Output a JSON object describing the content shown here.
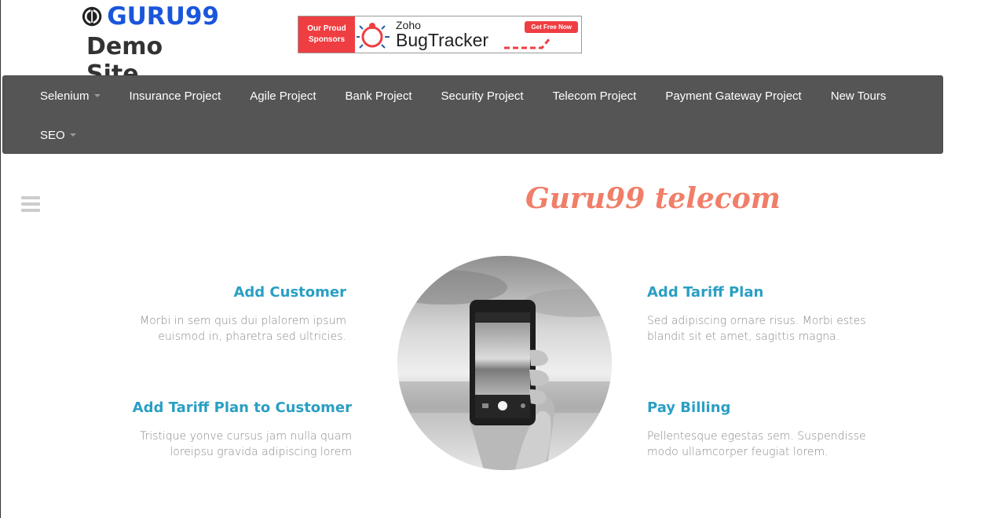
{
  "logo": {
    "brand": "GURU99",
    "subtitle": "Demo Site"
  },
  "sponsor": {
    "left_line1": "Our Proud",
    "left_line2": "Sponsors",
    "product_top": "Zoho",
    "product_name": "BugTracker",
    "cta": "Get Free Now"
  },
  "nav": {
    "row1": [
      {
        "label": "Selenium",
        "dropdown": true
      },
      {
        "label": "Insurance Project"
      },
      {
        "label": "Agile Project"
      },
      {
        "label": "Bank Project"
      },
      {
        "label": "Security Project"
      },
      {
        "label": "Telecom Project"
      },
      {
        "label": "Payment Gateway Project"
      },
      {
        "label": "New Tours"
      }
    ],
    "row2": [
      {
        "label": "SEO",
        "dropdown": true
      }
    ]
  },
  "brand_title": "Guru99 telecom",
  "features": {
    "add_customer": {
      "title": "Add Customer",
      "line1": "Morbi in sem quis dui plalorem ipsum",
      "line2": "euismod in, pharetra sed ultricies."
    },
    "add_tariff_plan": {
      "title": "Add Tariff Plan",
      "line1": "Sed adipiscing ornare risus. Morbi estes",
      "line2": "blandit sit et amet, sagittis magna."
    },
    "add_tariff_to_customer": {
      "title": "Add Tariff Plan to Customer",
      "line1": "Tristique yonve cursus jam nulla quam",
      "line2": "loreipsu gravida adipiscing lorem"
    },
    "pay_billing": {
      "title": "Pay Billing",
      "line1": "Pellentesque egestas sem. Suspendisse",
      "line2": "modo ullamcorper feugiat lorem."
    }
  },
  "colors": {
    "nav_bg": "#555555",
    "accent": "#2a9fc4",
    "brand_title": "#f07e68",
    "logo_blue": "#1a56db",
    "sponsor_red": "#ef3e42"
  }
}
